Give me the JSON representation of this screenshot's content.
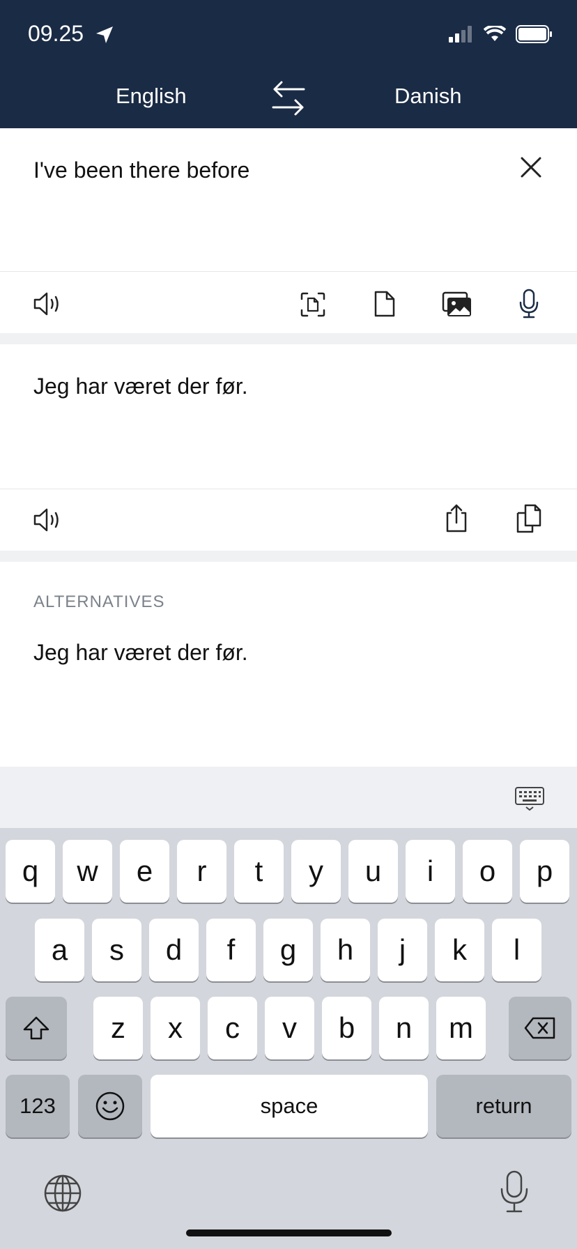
{
  "status": {
    "time": "09.25"
  },
  "header": {
    "source_lang": "English",
    "target_lang": "Danish"
  },
  "input": {
    "text": "I've been there before"
  },
  "translation": {
    "text": "Jeg har været der før."
  },
  "alternatives": {
    "label": "ALTERNATIVES",
    "items": [
      "Jeg har været der før."
    ]
  },
  "keyboard": {
    "row1": [
      "q",
      "w",
      "e",
      "r",
      "t",
      "y",
      "u",
      "i",
      "o",
      "p"
    ],
    "row2": [
      "a",
      "s",
      "d",
      "f",
      "g",
      "h",
      "j",
      "k",
      "l"
    ],
    "row3": [
      "z",
      "x",
      "c",
      "v",
      "b",
      "n",
      "m"
    ],
    "numbers_label": "123",
    "space_label": "space",
    "return_label": "return"
  },
  "colors": {
    "header_bg": "#1a2b45",
    "keyboard_bg": "#d3d6dc"
  }
}
